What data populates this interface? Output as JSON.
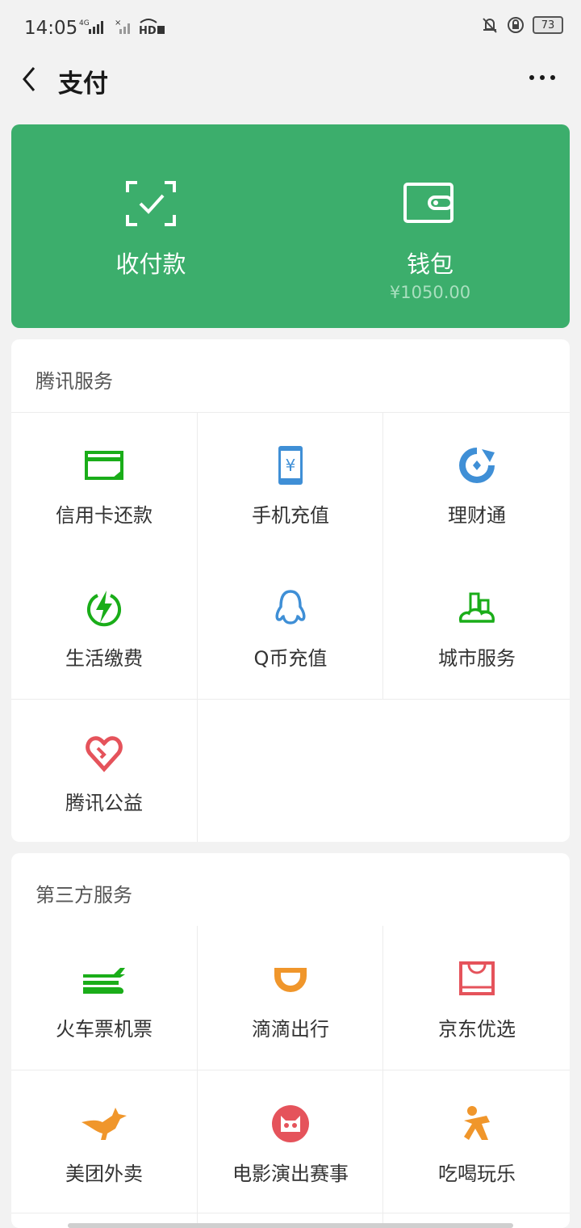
{
  "status_bar": {
    "time": "14:05",
    "network": "4G",
    "hd": "HD",
    "battery": "73"
  },
  "nav": {
    "title": "支付"
  },
  "pay_card": {
    "collect": {
      "label": "收付款",
      "icon": "scan-check-icon"
    },
    "wallet": {
      "label": "钱包",
      "balance": "¥1050.00",
      "icon": "wallet-icon"
    }
  },
  "tencent": {
    "title": "腾讯服务",
    "items": [
      {
        "label": "信用卡还款",
        "icon": "credit-card-icon",
        "color": "#1aad19"
      },
      {
        "label": "手机充值",
        "icon": "phone-yuan-icon",
        "color": "#3f8fd6"
      },
      {
        "label": "理财通",
        "icon": "licaitong-icon",
        "color": "#3f8fd6"
      },
      {
        "label": "生活缴费",
        "icon": "lightning-icon",
        "color": "#1aad19"
      },
      {
        "label": "Q币充值",
        "icon": "qq-penguin-icon",
        "color": "#3f8fd6"
      },
      {
        "label": "城市服务",
        "icon": "city-icon",
        "color": "#1aad19"
      },
      {
        "label": "腾讯公益",
        "icon": "heart-icon",
        "color": "#e5535b"
      }
    ]
  },
  "third_party": {
    "title": "第三方服务",
    "items": [
      {
        "label": "火车票机票",
        "icon": "train-plane-icon",
        "color": "#1aad19"
      },
      {
        "label": "滴滴出行",
        "icon": "didi-icon",
        "color": "#f0962b"
      },
      {
        "label": "京东优选",
        "icon": "shopping-bag-icon",
        "color": "#e5535b"
      },
      {
        "label": "美团外卖",
        "icon": "kangaroo-icon",
        "color": "#f0962b"
      },
      {
        "label": "电影演出赛事",
        "icon": "cat-icon",
        "color": "#e5535b"
      },
      {
        "label": "吃喝玩乐",
        "icon": "person-icon",
        "color": "#f0962b"
      }
    ]
  }
}
